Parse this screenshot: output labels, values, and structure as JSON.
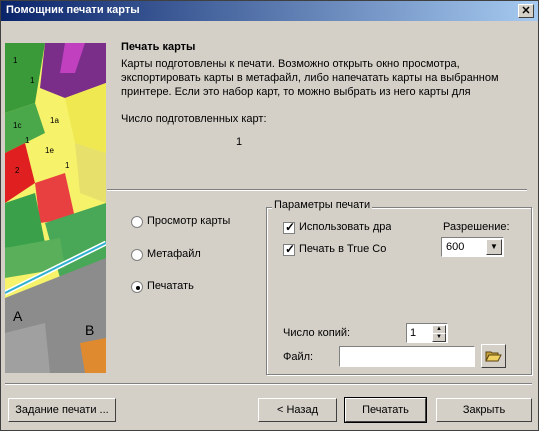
{
  "window": {
    "title": "Помощник печати карты",
    "close_glyph": "✕"
  },
  "intro": {
    "heading": "Печать карты",
    "description": "Карты подготовлены к печати. Возможно открыть окно просмотра, экспортировать карты в метафайл, либо напечатать карты на выбранном принтере. Если это набор карт, то можно выбрать из него карты для",
    "count_label": "Число подготовленных карт:",
    "count_value": "1"
  },
  "output_mode": {
    "options": [
      {
        "label": "Просмотр карты",
        "selected": false
      },
      {
        "label": "Метафайл",
        "selected": false
      },
      {
        "label": "Печатать",
        "selected": true
      }
    ]
  },
  "print_params": {
    "group_title": "Параметры печати",
    "use_driver": {
      "label": "Использовать драйв",
      "checked": true
    },
    "true_color": {
      "label": "Печать в True Co",
      "checked": true
    },
    "resolution_label": "Разрешение:",
    "resolution_value": "600",
    "copies_label": "Число копий:",
    "copies_value": "1",
    "file_label": "Файл:",
    "file_value": ""
  },
  "buttons": {
    "print_job": "Задание печати ...",
    "back": "< Назад",
    "print": "Печатать",
    "close": "Закрыть"
  },
  "map": {
    "labels": [
      "1",
      "1",
      "1c",
      "1a",
      "1",
      "1e",
      "2",
      "1",
      "A",
      "B"
    ]
  }
}
